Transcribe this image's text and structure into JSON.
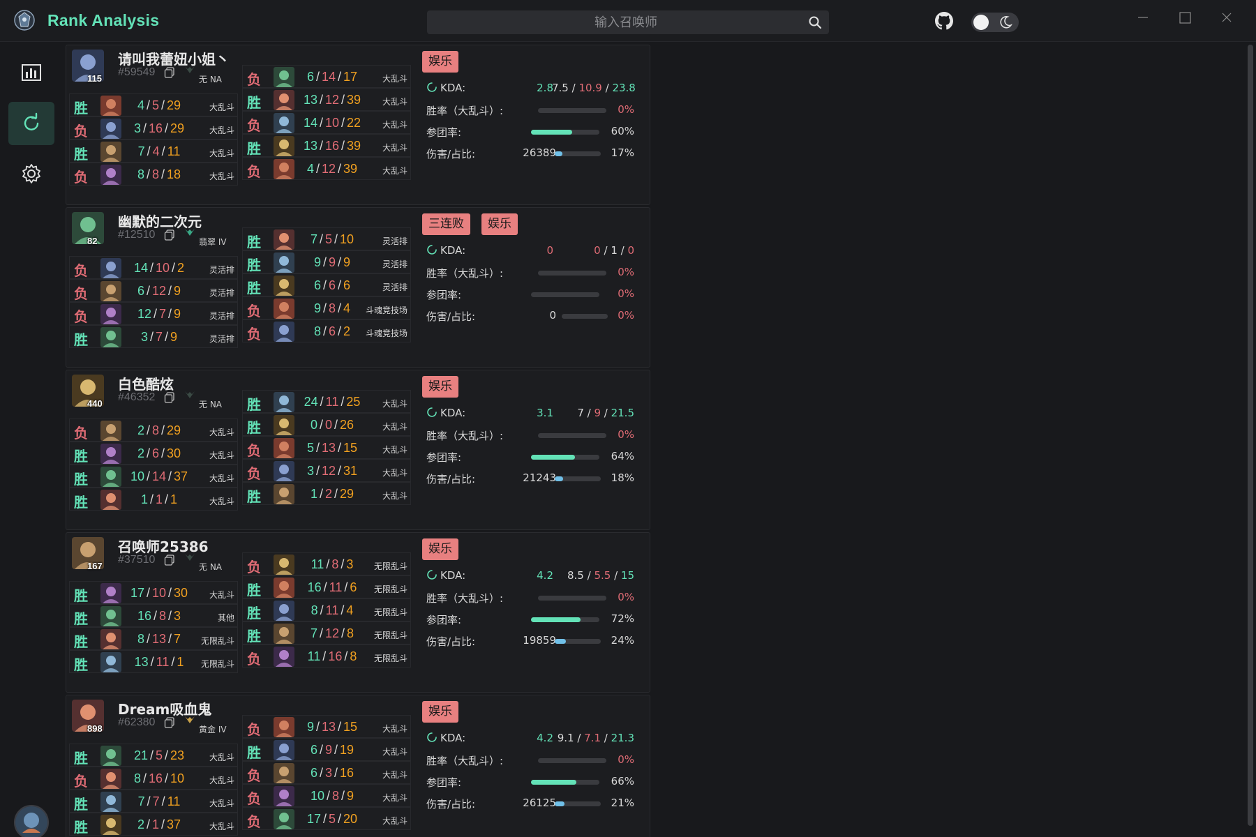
{
  "app": {
    "title": "Rank Analysis"
  },
  "search": {
    "placeholder": "输入召唤师"
  },
  "icons": {
    "logo": "app-logo-icon",
    "search": "search-icon",
    "github": "github-icon",
    "theme": "moon-icon",
    "stats": "bar-chart-icon",
    "refresh": "refresh-icon",
    "settings": "gear-icon"
  },
  "colors": {
    "accent": "#63e2b7",
    "lose": "#e06c75",
    "assist": "#f0a020",
    "tag_bg": "#e88080",
    "bar_blue": "#70c0e8"
  },
  "players": [
    {
      "name": "请叫我蕾妞小姐丶",
      "tag": "#59549",
      "level": "115",
      "rank": "无 NA",
      "tags": [
        "娱乐"
      ],
      "stats": {
        "kda_label": "KDA:",
        "kda": "2.8",
        "kda_k": "7.5",
        "kda_d": "10.9",
        "kda_a": "23.8",
        "winrate_label": "胜率（大乱斗）:",
        "winrate": "0%",
        "winrate_frac": 0,
        "kp_label": "参团率:",
        "kp": "60%",
        "kp_frac": 0.6,
        "dmg_label": "伤害/占比:",
        "dmg": "26389",
        "dmg_pct": "17%",
        "dmg_frac": 0.17
      },
      "left": [
        {
          "r": "胜",
          "k": "4",
          "d": "5",
          "a": "29",
          "mode": "大乱斗"
        },
        {
          "r": "负",
          "k": "3",
          "d": "16",
          "a": "29",
          "mode": "大乱斗"
        },
        {
          "r": "胜",
          "k": "7",
          "d": "4",
          "a": "11",
          "mode": "大乱斗"
        },
        {
          "r": "负",
          "k": "8",
          "d": "8",
          "a": "18",
          "mode": "大乱斗"
        }
      ],
      "right": [
        {
          "r": "负",
          "k": "6",
          "d": "14",
          "a": "17",
          "mode": "大乱斗"
        },
        {
          "r": "胜",
          "k": "13",
          "d": "12",
          "a": "39",
          "mode": "大乱斗"
        },
        {
          "r": "负",
          "k": "14",
          "d": "10",
          "a": "22",
          "mode": "大乱斗"
        },
        {
          "r": "胜",
          "k": "13",
          "d": "16",
          "a": "39",
          "mode": "大乱斗"
        },
        {
          "r": "负",
          "k": "4",
          "d": "12",
          "a": "39",
          "mode": "大乱斗"
        }
      ]
    },
    {
      "name": "幽默的二次元",
      "tag": "#12510",
      "level": "82",
      "rank": "翡翠 IV",
      "tags": [
        "三连败",
        "娱乐"
      ],
      "stats": {
        "kda_label": "KDA:",
        "kda": "0",
        "kda_k": "0",
        "kda_d": "1",
        "kda_a": "0",
        "winrate_label": "胜率（大乱斗）:",
        "winrate": "0%",
        "winrate_frac": 0,
        "kp_label": "参团率:",
        "kp": "0%",
        "kp_frac": 0,
        "dmg_label": "伤害/占比:",
        "dmg": "0",
        "dmg_pct": "0%",
        "dmg_frac": 0
      },
      "left": [
        {
          "r": "负",
          "k": "14",
          "d": "10",
          "a": "2",
          "mode": "灵活排"
        },
        {
          "r": "负",
          "k": "6",
          "d": "12",
          "a": "9",
          "mode": "灵活排"
        },
        {
          "r": "负",
          "k": "12",
          "d": "7",
          "a": "9",
          "mode": "灵活排"
        },
        {
          "r": "胜",
          "k": "3",
          "d": "7",
          "a": "9",
          "mode": "灵活排"
        }
      ],
      "right": [
        {
          "r": "胜",
          "k": "7",
          "d": "5",
          "a": "10",
          "mode": "灵活排"
        },
        {
          "r": "胜",
          "k": "9",
          "d": "9",
          "a": "9",
          "mode": "灵活排"
        },
        {
          "r": "胜",
          "k": "6",
          "d": "6",
          "a": "6",
          "mode": "灵活排"
        },
        {
          "r": "负",
          "k": "9",
          "d": "8",
          "a": "4",
          "mode": "斗魂竞技场"
        },
        {
          "r": "负",
          "k": "8",
          "d": "6",
          "a": "2",
          "mode": "斗魂竞技场"
        }
      ]
    },
    {
      "name": "白色酷炫",
      "tag": "#46352",
      "level": "440",
      "rank": "无 NA",
      "tags": [
        "娱乐"
      ],
      "stats": {
        "kda_label": "KDA:",
        "kda": "3.1",
        "kda_k": "7",
        "kda_d": "9",
        "kda_a": "21.5",
        "winrate_label": "胜率（大乱斗）:",
        "winrate": "0%",
        "winrate_frac": 0,
        "kp_label": "参团率:",
        "kp": "64%",
        "kp_frac": 0.64,
        "dmg_label": "伤害/占比:",
        "dmg": "21243",
        "dmg_pct": "18%",
        "dmg_frac": 0.18
      },
      "left": [
        {
          "r": "负",
          "k": "2",
          "d": "8",
          "a": "29",
          "mode": "大乱斗"
        },
        {
          "r": "胜",
          "k": "2",
          "d": "6",
          "a": "30",
          "mode": "大乱斗"
        },
        {
          "r": "胜",
          "k": "10",
          "d": "14",
          "a": "37",
          "mode": "大乱斗"
        },
        {
          "r": "胜",
          "k": "1",
          "d": "1",
          "a": "1",
          "mode": "大乱斗"
        }
      ],
      "right": [
        {
          "r": "胜",
          "k": "24",
          "d": "11",
          "a": "25",
          "mode": "大乱斗"
        },
        {
          "r": "胜",
          "k": "0",
          "d": "0",
          "a": "26",
          "mode": "大乱斗"
        },
        {
          "r": "负",
          "k": "5",
          "d": "13",
          "a": "15",
          "mode": "大乱斗"
        },
        {
          "r": "负",
          "k": "3",
          "d": "12",
          "a": "31",
          "mode": "大乱斗"
        },
        {
          "r": "胜",
          "k": "1",
          "d": "2",
          "a": "29",
          "mode": "大乱斗"
        }
      ]
    },
    {
      "name": "召唤师25386",
      "tag": "#37510",
      "level": "167",
      "rank": "无 NA",
      "tags": [
        "娱乐"
      ],
      "stats": {
        "kda_label": "KDA:",
        "kda": "4.2",
        "kda_k": "8.5",
        "kda_d": "5.5",
        "kda_a": "15",
        "winrate_label": "胜率（大乱斗）:",
        "winrate": "0%",
        "winrate_frac": 0,
        "kp_label": "参团率:",
        "kp": "72%",
        "kp_frac": 0.72,
        "dmg_label": "伤害/占比:",
        "dmg": "19859",
        "dmg_pct": "24%",
        "dmg_frac": 0.24
      },
      "left": [
        {
          "r": "胜",
          "k": "17",
          "d": "10",
          "a": "30",
          "mode": "大乱斗"
        },
        {
          "r": "胜",
          "k": "16",
          "d": "8",
          "a": "3",
          "mode": "其他"
        },
        {
          "r": "胜",
          "k": "8",
          "d": "13",
          "a": "7",
          "mode": "无限乱斗"
        },
        {
          "r": "胜",
          "k": "13",
          "d": "11",
          "a": "1",
          "mode": "无限乱斗"
        }
      ],
      "right": [
        {
          "r": "负",
          "k": "11",
          "d": "8",
          "a": "3",
          "mode": "无限乱斗"
        },
        {
          "r": "胜",
          "k": "16",
          "d": "11",
          "a": "6",
          "mode": "无限乱斗"
        },
        {
          "r": "胜",
          "k": "8",
          "d": "11",
          "a": "4",
          "mode": "无限乱斗"
        },
        {
          "r": "胜",
          "k": "7",
          "d": "12",
          "a": "8",
          "mode": "无限乱斗"
        },
        {
          "r": "负",
          "k": "11",
          "d": "16",
          "a": "8",
          "mode": "无限乱斗"
        }
      ]
    },
    {
      "name": "Dream吸血鬼",
      "tag": "#62380",
      "level": "898",
      "rank": "黄金 IV",
      "tags": [
        "娱乐"
      ],
      "stats": {
        "kda_label": "KDA:",
        "kda": "4.2",
        "kda_k": "9.1",
        "kda_d": "7.1",
        "kda_a": "21.3",
        "winrate_label": "胜率（大乱斗）:",
        "winrate": "0%",
        "winrate_frac": 0,
        "kp_label": "参团率:",
        "kp": "66%",
        "kp_frac": 0.66,
        "dmg_label": "伤害/占比:",
        "dmg": "26125",
        "dmg_pct": "21%",
        "dmg_frac": 0.21
      },
      "left": [
        {
          "r": "胜",
          "k": "21",
          "d": "5",
          "a": "23",
          "mode": "大乱斗"
        },
        {
          "r": "负",
          "k": "8",
          "d": "16",
          "a": "10",
          "mode": "大乱斗"
        },
        {
          "r": "胜",
          "k": "7",
          "d": "7",
          "a": "11",
          "mode": "大乱斗"
        },
        {
          "r": "胜",
          "k": "2",
          "d": "1",
          "a": "37",
          "mode": "大乱斗"
        }
      ],
      "right": [
        {
          "r": "负",
          "k": "9",
          "d": "13",
          "a": "15",
          "mode": "大乱斗"
        },
        {
          "r": "胜",
          "k": "6",
          "d": "9",
          "a": "19",
          "mode": "大乱斗"
        },
        {
          "r": "负",
          "k": "6",
          "d": "3",
          "a": "16",
          "mode": "大乱斗"
        },
        {
          "r": "负",
          "k": "10",
          "d": "8",
          "a": "9",
          "mode": "大乱斗"
        },
        {
          "r": "负",
          "k": "17",
          "d": "5",
          "a": "20",
          "mode": "大乱斗"
        }
      ]
    }
  ]
}
